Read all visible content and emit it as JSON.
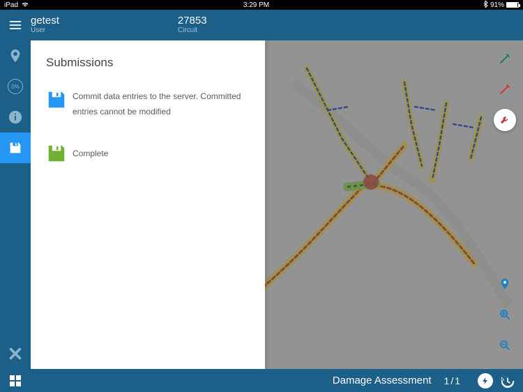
{
  "statusbar": {
    "device": "iPad",
    "wifi": true,
    "time": "3:29 PM",
    "bluetooth": true,
    "batteryText": "91%"
  },
  "topbar": {
    "user": {
      "name": "getest",
      "label": "User"
    },
    "circuit": {
      "id": "27853",
      "label": "Circuit"
    }
  },
  "sidenav": {
    "percent": "0%"
  },
  "panel": {
    "title": "Submissions",
    "commitText": "Commit data entries to the server. Committed entries cannot be modified",
    "completeText": "Complete"
  },
  "bottombar": {
    "title": "Damage Assessment",
    "page": "1",
    "sep": "/",
    "total": "1"
  },
  "colors": {
    "blue": "#2596f3",
    "green": "#6fb133"
  }
}
